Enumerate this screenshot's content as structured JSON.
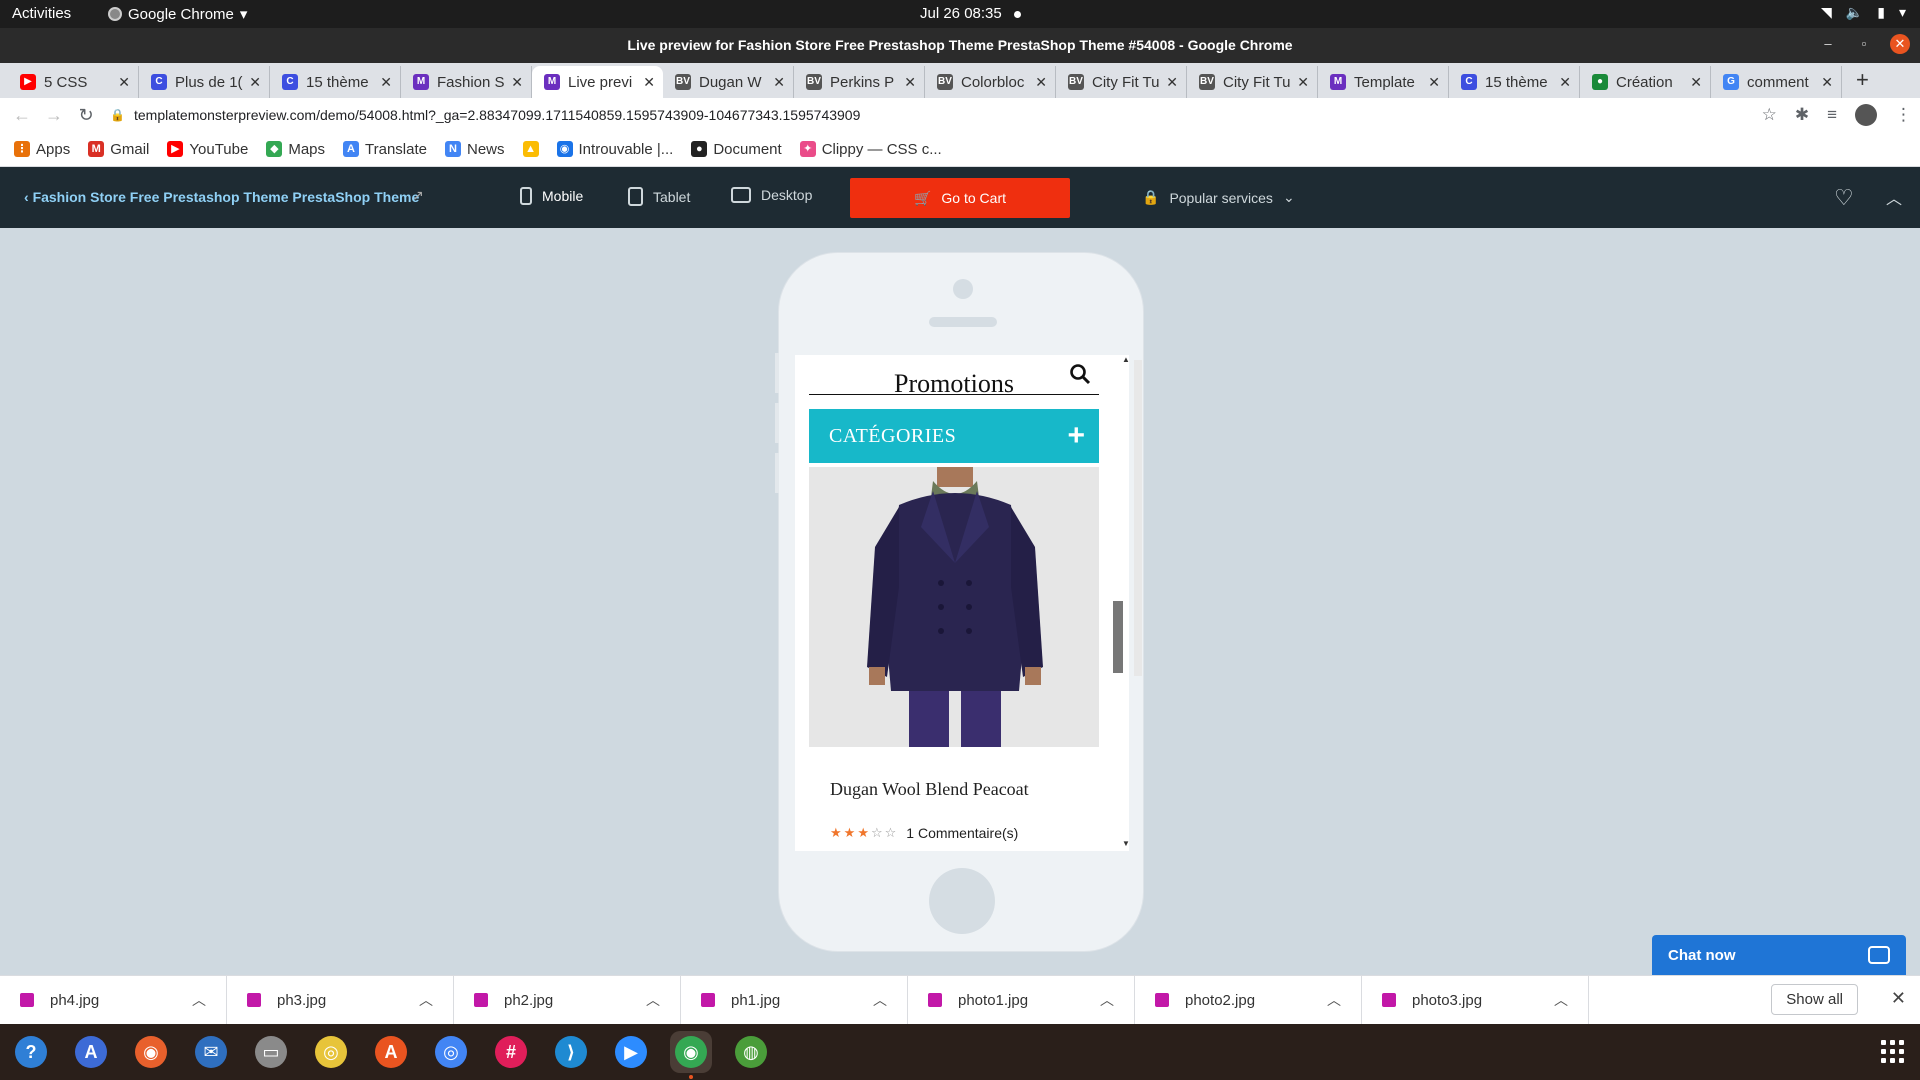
{
  "system": {
    "activities": "Activities",
    "app_name": "Google Chrome",
    "clock": "Jul 26  08:35"
  },
  "window": {
    "title": "Live preview for Fashion Store Free Prestashop Theme PrestaShop Theme #54008 - Google Chrome"
  },
  "tabs": [
    {
      "label": "5 CSS",
      "favicon": "youtube-icon",
      "color": "#ff0000"
    },
    {
      "label": "Plus de 1(",
      "favicon": "c-icon",
      "color": "#3d4ee0"
    },
    {
      "label": "15 thème",
      "favicon": "c-icon",
      "color": "#3d4ee0"
    },
    {
      "label": "Fashion S",
      "favicon": "template-monster-icon",
      "color": "#6b2fbf"
    },
    {
      "label": "Live previ",
      "favicon": "template-monster-icon",
      "color": "#6b2fbf",
      "active": true
    },
    {
      "label": "Dugan W",
      "favicon": "bv-icon",
      "color": "#555555"
    },
    {
      "label": "Perkins P",
      "favicon": "bv-icon",
      "color": "#555555"
    },
    {
      "label": "Colorbloc",
      "favicon": "bv-icon",
      "color": "#555555"
    },
    {
      "label": "City Fit Tu",
      "favicon": "bv-icon",
      "color": "#555555"
    },
    {
      "label": "City Fit Tu",
      "favicon": "bv-icon",
      "color": "#555555"
    },
    {
      "label": "Template",
      "favicon": "template-monster-icon",
      "color": "#6b2fbf"
    },
    {
      "label": "15 thème",
      "favicon": "c-icon",
      "color": "#3d4ee0"
    },
    {
      "label": "Création",
      "favicon": "green-circle-icon",
      "color": "#1a8a3a"
    },
    {
      "label": "comment",
      "favicon": "google-icon",
      "color": "#4285f4"
    }
  ],
  "address": {
    "url": "templatemonsterpreview.com/demo/54008.html?_ga=2.88347099.1711540859.1595743909-104677343.1595743909"
  },
  "bookmarks": [
    {
      "label": "Apps",
      "icon": "apps-grid-icon",
      "color": "#e8710a"
    },
    {
      "label": "Gmail",
      "icon": "gmail-icon",
      "color": "#d93025"
    },
    {
      "label": "YouTube",
      "icon": "youtube-icon",
      "color": "#ff0000"
    },
    {
      "label": "Maps",
      "icon": "maps-icon",
      "color": "#34a853"
    },
    {
      "label": "Translate",
      "icon": "translate-icon",
      "color": "#4285f4"
    },
    {
      "label": "News",
      "icon": "news-icon",
      "color": "#4285f4"
    },
    {
      "label": "",
      "icon": "drive-icon",
      "color": "#fbbc04"
    },
    {
      "label": "Introuvable |...",
      "icon": "graduation-icon",
      "color": "#1a73e8"
    },
    {
      "label": "Document",
      "icon": "github-icon",
      "color": "#222222"
    },
    {
      "label": "Clippy — CSS c...",
      "icon": "clippy-icon",
      "color": "#ea4c89"
    }
  ],
  "preview_bar": {
    "back_label": "Fashion Store Free Prestashop Theme PrestaShop Theme",
    "mobile": "Mobile",
    "tablet": "Tablet",
    "desktop": "Desktop",
    "cart": "Go to Cart",
    "popular": "Popular services"
  },
  "store": {
    "section_title": "Promotions",
    "categories": "CATÉGORIES",
    "product_name": "Dugan Wool Blend Peacoat",
    "rating": 3,
    "rating_max": 5,
    "comments": "1 Commentaire(s)",
    "accent": "#17b8c9"
  },
  "chat": {
    "label": "Chat now"
  },
  "downloads": [
    {
      "file": "ph4.jpg"
    },
    {
      "file": "ph3.jpg"
    },
    {
      "file": "ph2.jpg"
    },
    {
      "file": "ph1.jpg"
    },
    {
      "file": "photo1.jpg"
    },
    {
      "file": "photo2.jpg"
    },
    {
      "file": "photo3.jpg"
    }
  ],
  "show_all": "Show all",
  "dock": [
    {
      "icon": "help-icon",
      "color": "#2f7fd6"
    },
    {
      "icon": "translate-app-icon",
      "color": "#3d6bd6"
    },
    {
      "icon": "firefox-icon",
      "color": "#e8602c"
    },
    {
      "icon": "thunderbird-icon",
      "color": "#2f6fbf"
    },
    {
      "icon": "files-icon",
      "color": "#8a8a8a"
    },
    {
      "icon": "rhythmbox-icon",
      "color": "#e7c43a"
    },
    {
      "icon": "software-center-icon",
      "color": "#e95420"
    },
    {
      "icon": "chromium-icon",
      "color": "#4285f4"
    },
    {
      "icon": "slack-icon",
      "color": "#e01e5a"
    },
    {
      "icon": "vscode-icon",
      "color": "#1f8ad2"
    },
    {
      "icon": "zoom-icon",
      "color": "#2d8cff"
    },
    {
      "icon": "chrome-icon",
      "color": "#34a853",
      "active": true
    },
    {
      "icon": "browser-globe-icon",
      "color": "#4a9d3a"
    }
  ]
}
